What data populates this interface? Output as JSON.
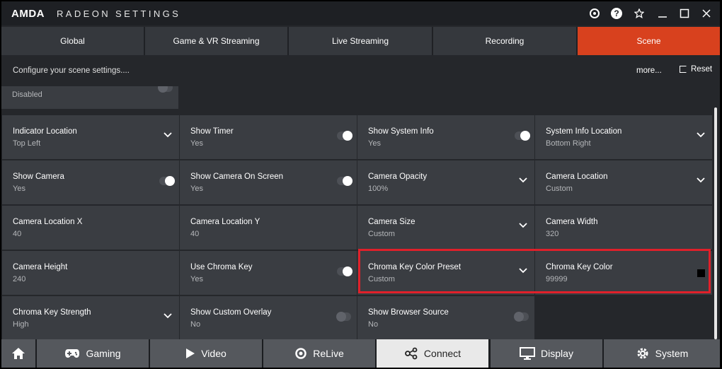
{
  "titlebar": {
    "logo": "AMDA",
    "title": "RADEON SETTINGS"
  },
  "tabs": [
    {
      "label": "Global"
    },
    {
      "label": "Game & VR Streaming"
    },
    {
      "label": "Live Streaming"
    },
    {
      "label": "Recording"
    },
    {
      "label": "Scene"
    }
  ],
  "active_tab": "Scene",
  "subheader": {
    "description": "Configure your scene settings....",
    "more": "more...",
    "reset": "Reset"
  },
  "partial_tile": {
    "value": "Disabled"
  },
  "settings": [
    {
      "label": "Indicator Location",
      "value": "Top Left",
      "control": "dropdown"
    },
    {
      "label": "Show Timer",
      "value": "Yes",
      "control": "toggle-on"
    },
    {
      "label": "Show System Info",
      "value": "Yes",
      "control": "toggle-on"
    },
    {
      "label": "System Info Location",
      "value": "Bottom Right",
      "control": "dropdown"
    },
    {
      "label": "Show Camera",
      "value": "Yes",
      "control": "toggle-on"
    },
    {
      "label": "Show Camera On Screen",
      "value": "Yes",
      "control": "toggle-on"
    },
    {
      "label": "Camera Opacity",
      "value": "100%",
      "control": "dropdown"
    },
    {
      "label": "Camera Location",
      "value": "Custom",
      "control": "dropdown"
    },
    {
      "label": "Camera Location X",
      "value": "40",
      "control": "none"
    },
    {
      "label": "Camera Location Y",
      "value": "40",
      "control": "none"
    },
    {
      "label": "Camera Size",
      "value": "Custom",
      "control": "dropdown"
    },
    {
      "label": "Camera Width",
      "value": "320",
      "control": "none"
    },
    {
      "label": "Camera Height",
      "value": "240",
      "control": "none"
    },
    {
      "label": "Use Chroma Key",
      "value": "Yes",
      "control": "toggle-on"
    },
    {
      "label": "Chroma Key Color Preset",
      "value": "Custom",
      "control": "dropdown"
    },
    {
      "label": "Chroma Key Color",
      "value": "99999",
      "control": "color",
      "swatch": "#000000"
    },
    {
      "label": "Chroma Key Strength",
      "value": "High",
      "control": "dropdown"
    },
    {
      "label": "Show Custom Overlay",
      "value": "No",
      "control": "toggle-off"
    },
    {
      "label": "Show Browser Source",
      "value": "No",
      "control": "toggle-off"
    }
  ],
  "bottomnav": [
    {
      "label": "",
      "icon": "home-icon"
    },
    {
      "label": "Gaming",
      "icon": "gamepad-icon"
    },
    {
      "label": "Video",
      "icon": "play-icon"
    },
    {
      "label": "ReLive",
      "icon": "relive-icon"
    },
    {
      "label": "Connect",
      "icon": "connect-icon"
    },
    {
      "label": "Display",
      "icon": "monitor-icon"
    },
    {
      "label": "System",
      "icon": "gear-icon"
    }
  ],
  "active_nav": "Connect",
  "colors": {
    "accent": "#d8411e",
    "highlight": "#e0202a",
    "tile": "#3a3d42",
    "background": "#25272b"
  }
}
